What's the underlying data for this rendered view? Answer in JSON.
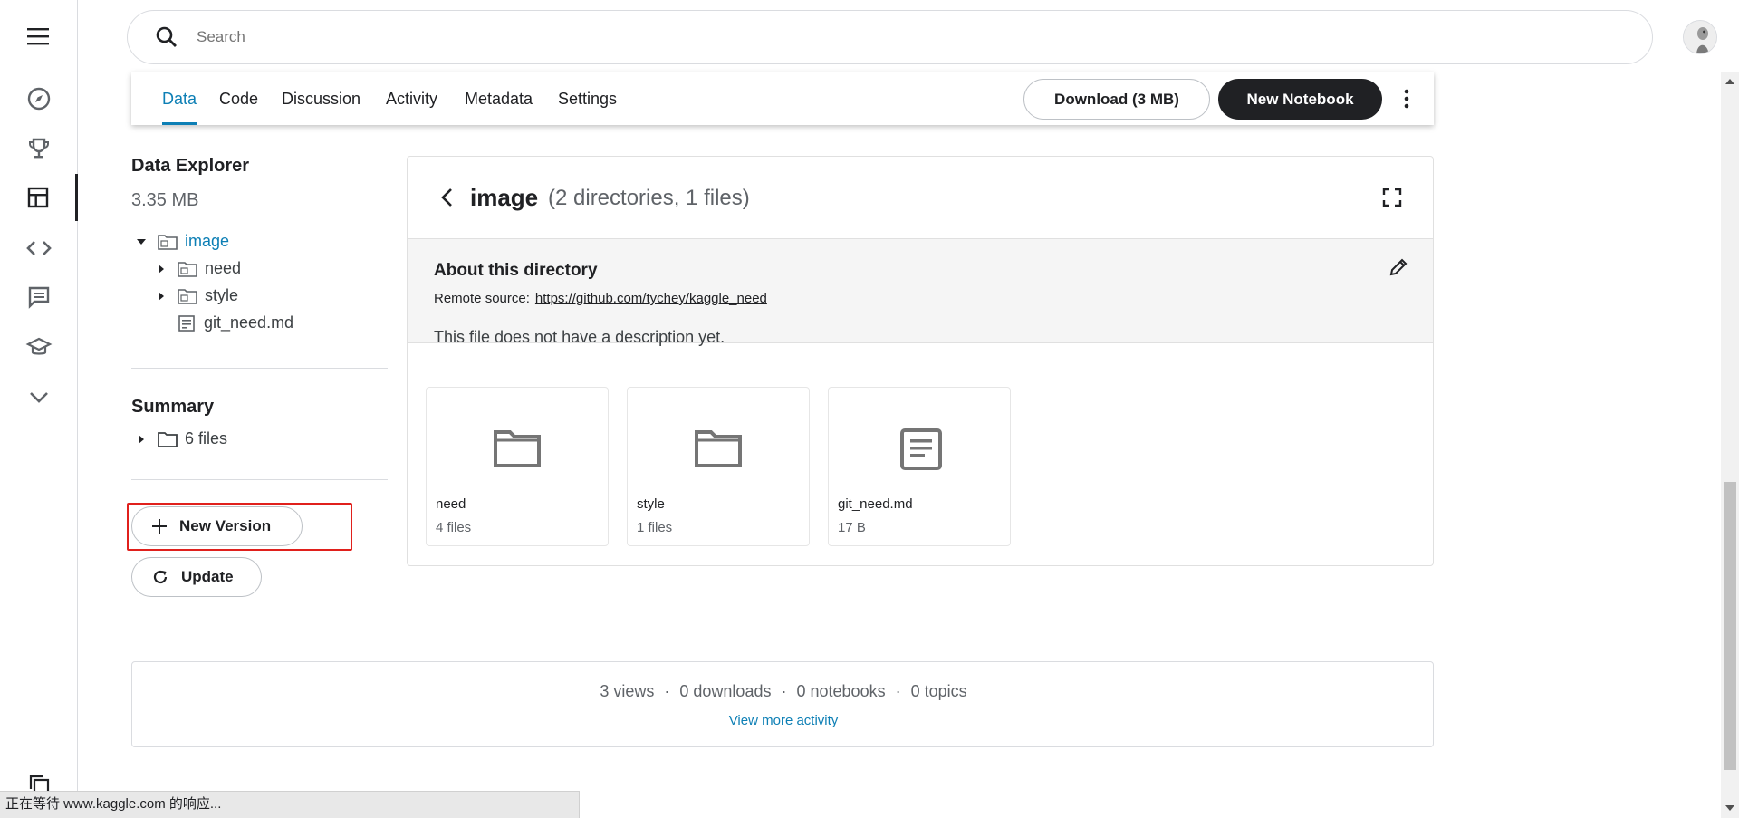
{
  "search": {
    "placeholder": "Search"
  },
  "tabs": [
    {
      "label": "Data"
    },
    {
      "label": "Code"
    },
    {
      "label": "Discussion"
    },
    {
      "label": "Activity"
    },
    {
      "label": "Metadata"
    },
    {
      "label": "Settings"
    }
  ],
  "actions": {
    "download": "Download (3 MB)",
    "new_notebook": "New Notebook"
  },
  "explorer": {
    "title": "Data Explorer",
    "size": "3.35 MB",
    "tree": [
      {
        "label": "image"
      },
      {
        "label": "need"
      },
      {
        "label": "style"
      },
      {
        "label": "git_need.md"
      }
    ]
  },
  "summary": {
    "title": "Summary",
    "files": "6 files"
  },
  "buttons": {
    "new_version": "New Version",
    "update": "Update"
  },
  "directory": {
    "name": "image",
    "meta": "(2 directories, 1 files)",
    "about_title": "About this directory",
    "remote_label": "Remote source:",
    "remote_url": "https://github.com/tychey/kaggle_need",
    "description": "This file does not have a description yet."
  },
  "cards": [
    {
      "name": "need",
      "sub": "4 files",
      "icon": "folder-icon"
    },
    {
      "name": "style",
      "sub": "1 files",
      "icon": "folder-icon"
    },
    {
      "name": "git_need.md",
      "sub": "17 B",
      "icon": "document-icon"
    }
  ],
  "stats": {
    "views": "3 views",
    "downloads": "0 downloads",
    "notebooks": "0 notebooks",
    "topics": "0 topics",
    "sep": "·",
    "more": "View more activity"
  },
  "statusbar": {
    "text": "正在等待 www.kaggle.com 的响应..."
  },
  "colors": {
    "accent": "#0d7fb5",
    "dark": "#202124",
    "highlight": "#e0201c"
  }
}
